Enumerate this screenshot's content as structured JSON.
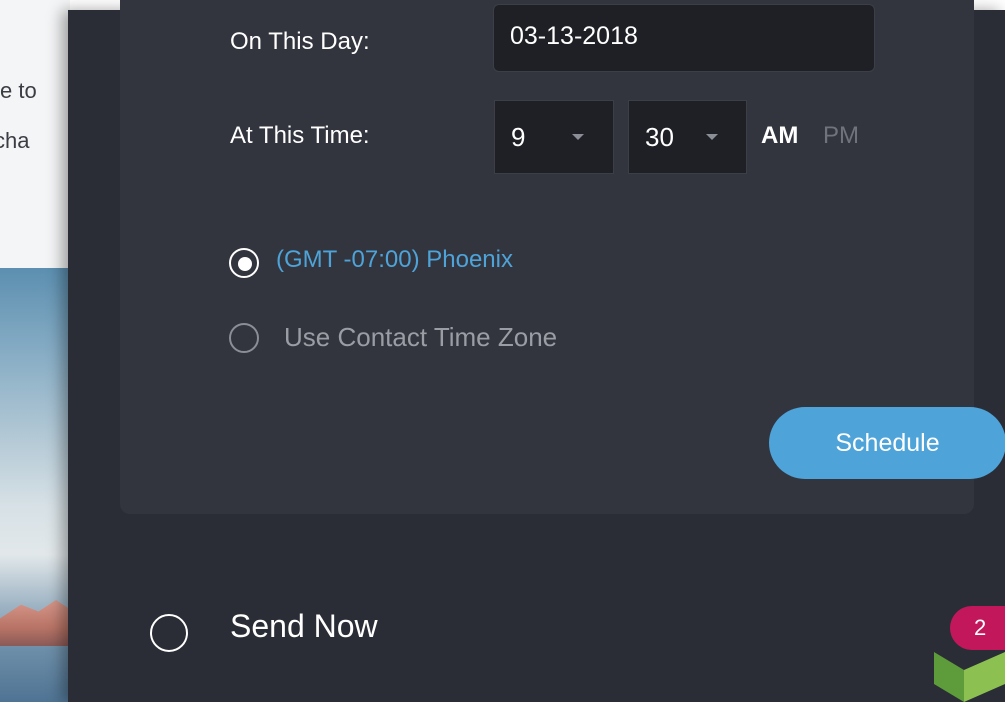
{
  "background": {
    "text_line_1": "e to",
    "text_line_2": "cha"
  },
  "schedule_form": {
    "date_label": "On This Day:",
    "date_value": "03-13-2018",
    "time_label": "At This Time:",
    "hour_value": "9",
    "minute_value": "30",
    "am_label": "AM",
    "pm_label": "PM",
    "timezone_options": [
      {
        "label": "(GMT -07:00) Phoenix",
        "selected": true
      },
      {
        "label": "Use Contact Time Zone",
        "selected": false
      }
    ],
    "schedule_button": "Schedule"
  },
  "send_now": {
    "label": "Send Now",
    "selected": false
  },
  "notification_badge": {
    "count": "2"
  },
  "colors": {
    "modal_bg": "#2a2d35",
    "card_bg": "#32353e",
    "accent_blue": "#4ea3d9",
    "badge_pink": "#c2185b"
  },
  "icons": {
    "hour_dropdown": "chevron-down-icon",
    "minute_dropdown": "chevron-down-icon",
    "brand_logo": "logo-icon"
  }
}
